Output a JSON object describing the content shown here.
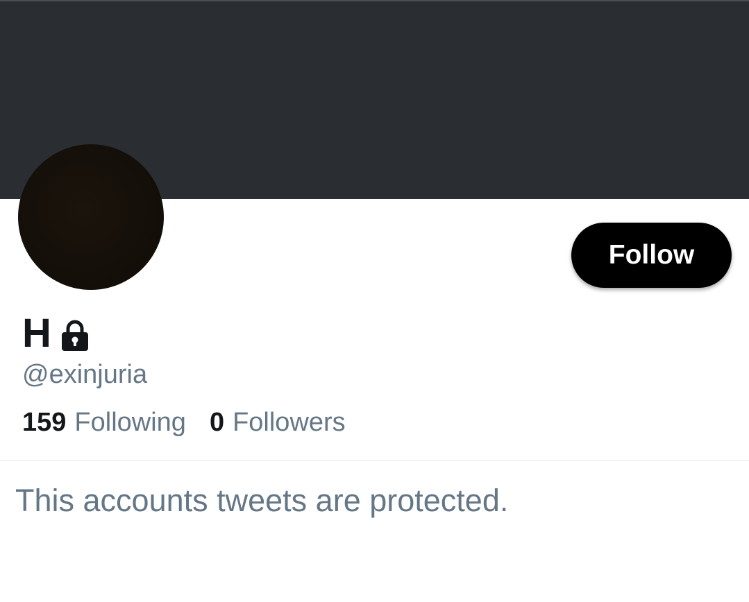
{
  "profile": {
    "display_name": "H",
    "handle": "@exinjuria",
    "protected_icon": "lock-icon",
    "follow_button_label": "Follow",
    "following_count": "159",
    "following_label": "Following",
    "followers_count": "0",
    "followers_label": "Followers",
    "protected_message": "This accounts tweets are protected."
  },
  "colors": {
    "banner": "#2a2e32",
    "avatar": "#140f09",
    "button_bg": "#000000",
    "button_text": "#ffffff",
    "primary_text": "#14171a",
    "secondary_text": "#657786",
    "divider": "#e1e8ed"
  }
}
